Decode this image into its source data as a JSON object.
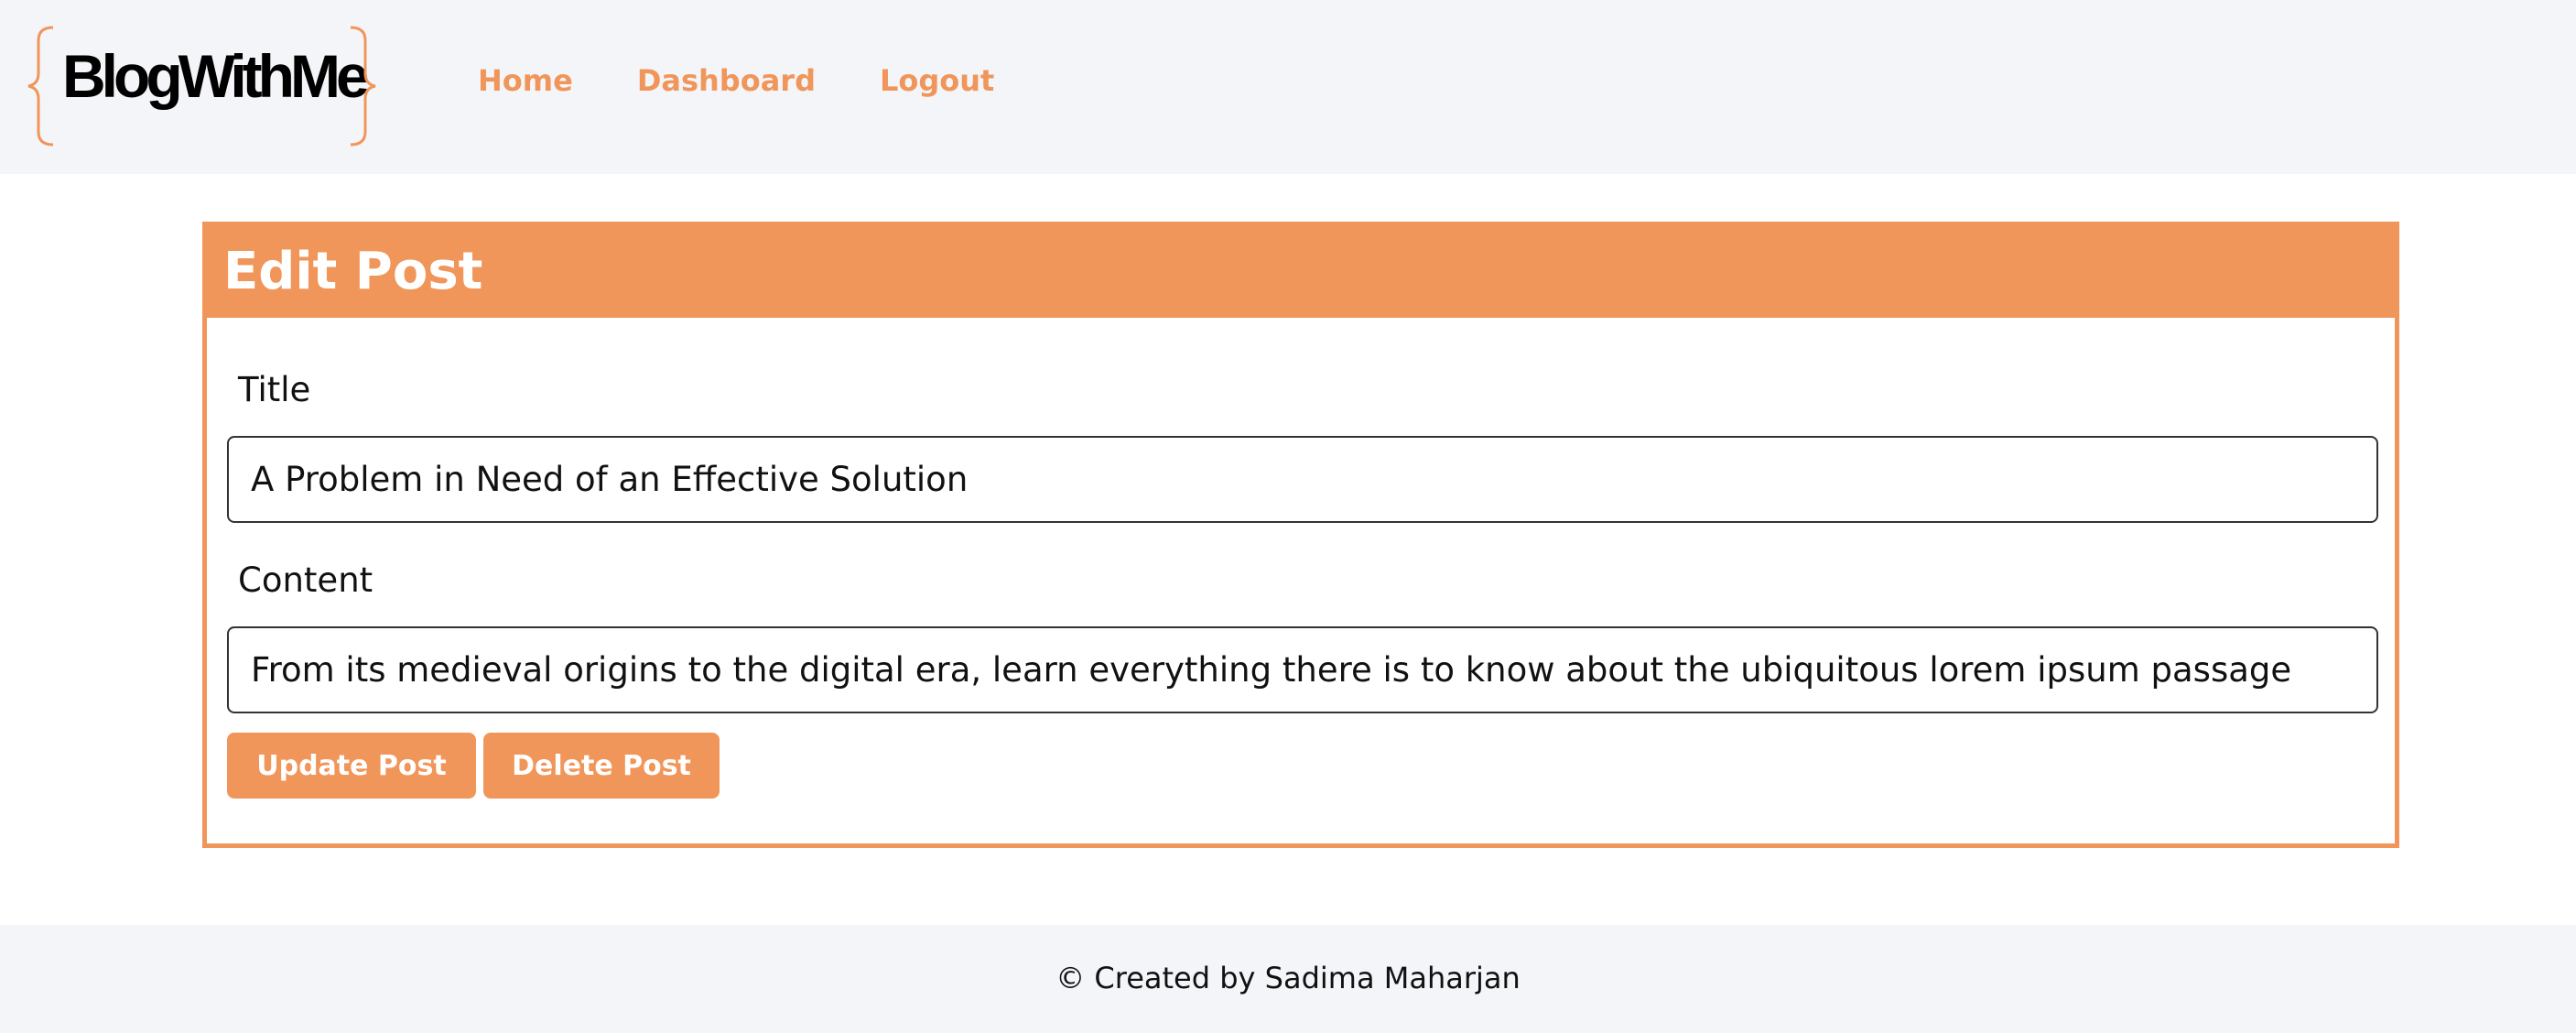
{
  "header": {
    "logo_text": "BlogWithMe",
    "nav": [
      {
        "label": "Home"
      },
      {
        "label": "Dashboard"
      },
      {
        "label": "Logout"
      }
    ]
  },
  "edit_post": {
    "heading": "Edit Post",
    "title_label": "Title",
    "title_value": "A Problem in Need of an Effective Solution",
    "content_label": "Content",
    "content_value": "From its medieval origins to the digital era, learn everything there is to know about the ubiquitous lorem ipsum passage",
    "update_button": "Update Post",
    "delete_button": "Delete Post"
  },
  "footer": {
    "text": "© Created by Sadima Maharjan"
  },
  "colors": {
    "accent": "#f1965a",
    "header_bg": "#f4f5f9",
    "text": "#111111"
  }
}
